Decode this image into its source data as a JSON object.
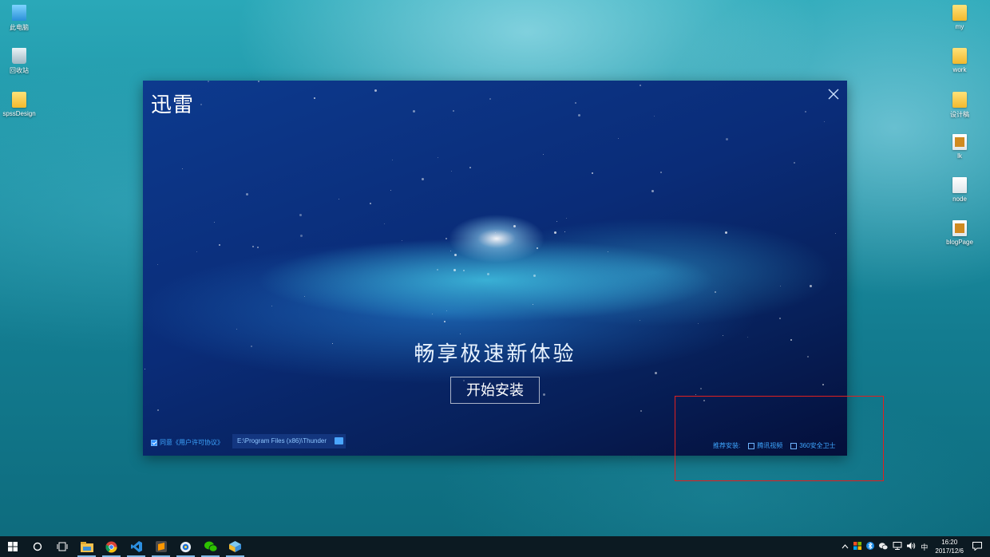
{
  "desktop": {
    "left_icons": [
      {
        "label": "此电脑",
        "icon": "this-pc-icon"
      },
      {
        "label": "回收站",
        "icon": "recycle-bin-icon"
      },
      {
        "label": "spssDesign",
        "icon": "folder-icon"
      }
    ],
    "right_icons": [
      {
        "label": "my",
        "icon": "folder-icon"
      },
      {
        "label": "work",
        "icon": "folder-icon"
      },
      {
        "label": "设计稿",
        "icon": "folder-icon"
      },
      {
        "label": "lk",
        "icon": "file-icon"
      },
      {
        "label": "node",
        "icon": "file-icon"
      },
      {
        "label": "blogPage",
        "icon": "file-icon"
      }
    ]
  },
  "installer": {
    "title": "迅雷",
    "slogan": "畅享极速新体验",
    "install_button": "开始安装",
    "agree_label": "同意《用户许可协议》",
    "agree_checked": true,
    "install_path": "E:\\Program Files (x86)\\Thunder",
    "recommend_label": "推荐安装:",
    "recommend_options": [
      {
        "label": "腾讯视频",
        "checked": false
      },
      {
        "label": "360安全卫士",
        "checked": false
      }
    ],
    "close_icon": "close-icon"
  },
  "taskbar": {
    "apps": [
      "start-icon",
      "cortana-icon",
      "task-view-icon",
      "file-explorer-icon",
      "chrome-icon",
      "vscode-icon",
      "sublime-icon",
      "qq-browser-icon",
      "wechat-icon",
      "installer-icon"
    ],
    "tray": {
      "ime": "中",
      "time": "16:20",
      "date": "2017/12/6"
    }
  },
  "colors": {
    "accent": "#3ea6ff",
    "highlight": "#e02020",
    "taskbar": "#0c1a22"
  }
}
